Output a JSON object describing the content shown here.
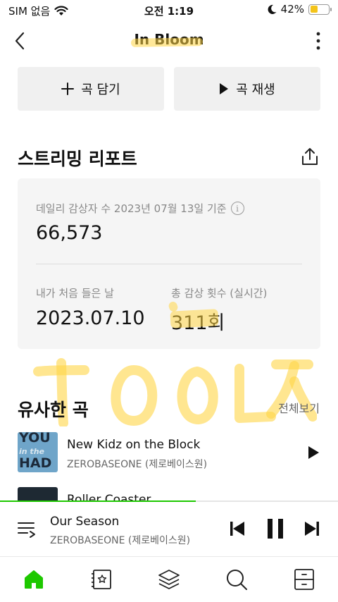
{
  "status_bar": {
    "carrier": "SIM 없음",
    "time": "오전 1:19",
    "battery_percent": "42%",
    "battery_level": 0.42,
    "wifi_icon": "wifi-icon",
    "moon_icon": "moon-icon"
  },
  "header": {
    "title": "In Bloom",
    "back_icon": "chevron-left-icon",
    "more_icon": "more-vertical-icon"
  },
  "actions": {
    "add_label": "곡 담기",
    "play_label": "곡 재생"
  },
  "report": {
    "title": "스트리밍 리포트",
    "daily_label": "데일리 감상자 수 2023년 07월 13일 기준",
    "info_glyph": "i",
    "daily_value": "66,573",
    "first_listen_label": "내가 처음 들은 날",
    "first_listen_value": "2023.07.10",
    "total_plays_label": "총 감상 횟수 (실시간)",
    "total_plays_value": "311회"
  },
  "similar": {
    "title": "유사한 곡",
    "see_all": "전체보기",
    "songs": [
      {
        "title": "New Kidz on the Block",
        "artist": "ZEROBASEONE (제로베이스원)",
        "art_text": "YOU\nHAD"
      },
      {
        "title": "Roller Coaster",
        "artist": ""
      }
    ]
  },
  "player": {
    "progress": 0.58,
    "title": "Our Season",
    "artist": "ZEROBASEONE (제로베이스원)"
  },
  "nav": {
    "items": [
      "home-icon",
      "library-icon",
      "layers-icon",
      "search-icon",
      "storage-icon"
    ],
    "active_color": "#1ec800"
  },
  "colors": {
    "accent_green": "#1ec800",
    "highlighter": "#ffd646"
  }
}
